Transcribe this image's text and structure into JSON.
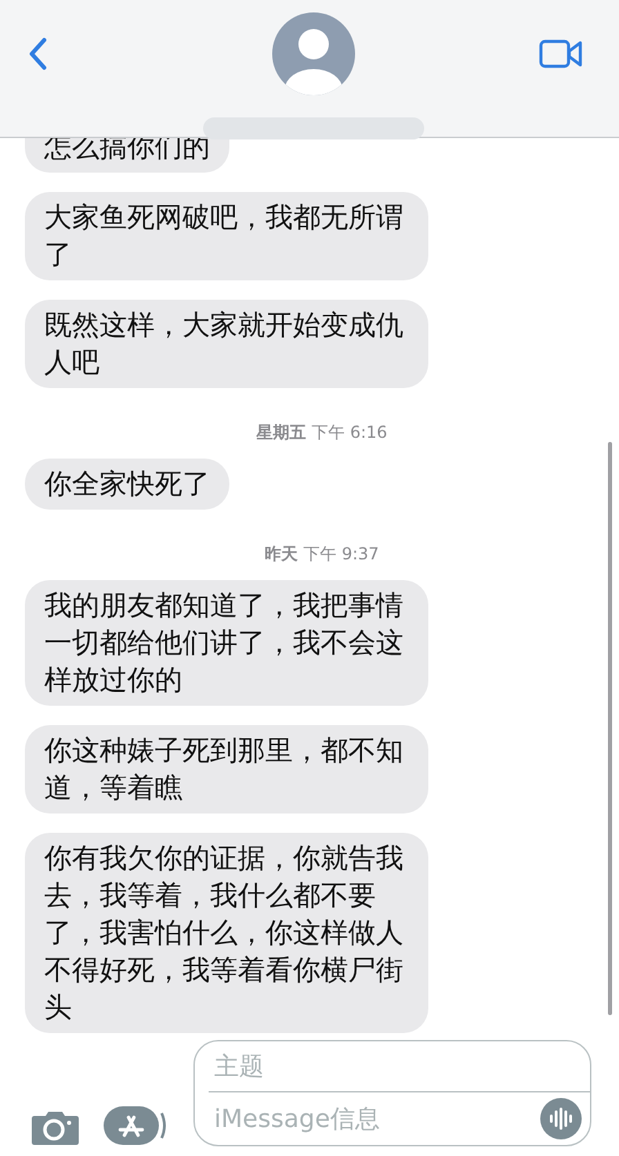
{
  "messages": [
    {
      "kind": "bubble",
      "text": "怎么搞你们的"
    },
    {
      "kind": "bubble",
      "text": "大家鱼死网破吧，我都无所谓了"
    },
    {
      "kind": "bubble",
      "text": "既然这样，大家就开始变成仇人吧"
    },
    {
      "kind": "time",
      "day": "星期五",
      "time": "下午 6:16"
    },
    {
      "kind": "bubble",
      "text": "你全家快死了"
    },
    {
      "kind": "time",
      "day": "昨天",
      "time": "下午 9:37"
    },
    {
      "kind": "bubble",
      "text": "我的朋友都知道了，我把事情一切都给他们讲了，我不会这样放过你的"
    },
    {
      "kind": "bubble",
      "text": "你这种婊子死到那里，都不知道，等着瞧"
    },
    {
      "kind": "bubble",
      "text": "你有我欠你的证据，你就告我去，我等着，我什么都不要了，我害怕什么，你这样做人不得好死，我等着看你横尸街头"
    }
  ],
  "composer": {
    "subject_placeholder": "主题",
    "message_placeholder": "iMessage信息"
  }
}
